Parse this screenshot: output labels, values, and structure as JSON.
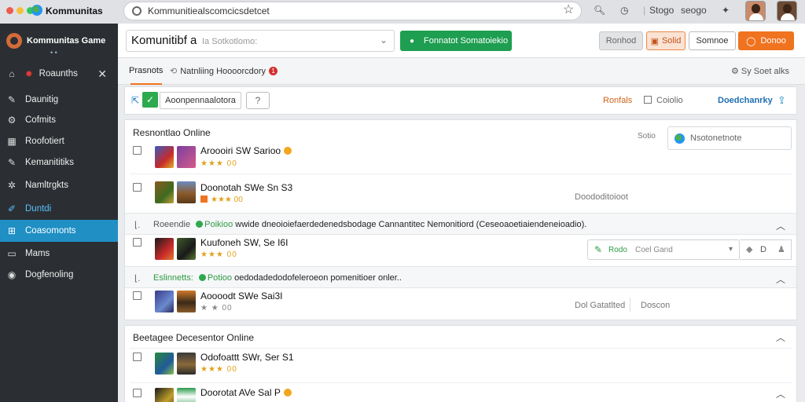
{
  "chrome": {
    "app_title": "Kommunitas",
    "url": "Kommunitiealscomcicsdetcet",
    "ctl1": "Stogo",
    "ctl2": "seogo",
    "colors": {
      "red": "#ee5b50",
      "yellow": "#f6be3a",
      "green": "#34c759"
    }
  },
  "sidebar": {
    "brand": "Kommunitas Game",
    "brand_sub": "• •",
    "items": [
      {
        "label": "Roaunths",
        "icon": "home-icon"
      },
      {
        "label": "Daunitig",
        "icon": "wrench-icon"
      },
      {
        "label": "Cofmits",
        "icon": "gear-icon"
      },
      {
        "label": "Roofotiert",
        "icon": "calendar-icon"
      },
      {
        "label": "Kemanititiks",
        "icon": "wrench-icon"
      },
      {
        "label": "Namltrgkts",
        "icon": "settings-icon"
      },
      {
        "label": "Duntdi",
        "icon": "pencil-icon"
      },
      {
        "label": "Coasomonts",
        "icon": "grid-icon"
      },
      {
        "label": "Mams",
        "icon": "list-icon"
      },
      {
        "label": "Dogfenoling",
        "icon": "circle-icon"
      }
    ]
  },
  "header": {
    "search_label": "Komunitibf a",
    "search_placeholder": "Ia Sotkotlomo:",
    "green_button": "Fonnatot Somatoiekio",
    "gray_button": "Ronhod",
    "orange_outline_button": "Solid",
    "white_button": "Somnoe",
    "orange_button": "Donoo"
  },
  "tabs": {
    "active": "Prasnots",
    "second": "Natnliing Hoooorcdory",
    "second_badge": "1",
    "right": "⚙ Sy Soet alks"
  },
  "toolbar": {
    "input_value": "Aoonpennaalotora",
    "orange_link": "Ronfals",
    "mid_link": "Coiolio",
    "blue_link": "Doedchanrky"
  },
  "panel1": {
    "title": "Resnontlao Online",
    "side_label": "Sotio",
    "side_search": "Nsotonetnote",
    "rows": [
      {
        "name": "Aroooiri SW Sarioo",
        "meta": "★★★ 00",
        "note": ""
      },
      {
        "name": "Doonotah SWe Sn S3",
        "meta": "★★★ 00",
        "note": "Doododitoioot"
      }
    ],
    "info1": {
      "prefix": "Roeendie",
      "green": "Poikioo",
      "text": "wwide dneoioiefaerdedenedsbodage Cannantitec Nemonitiord (Ceseoaoetiaiendeneioadio)."
    },
    "row3": {
      "name": "Kuufoneh SW, Se I6I",
      "meta": "★★★ 00",
      "combo_green": "Rodo",
      "combo_text": "Coel Gand",
      "mini": "D"
    },
    "info2": {
      "prefix": "Eslinnetts:",
      "green": "Potioo",
      "text": "oedodadedodofeleroeon pomenitioer onler.."
    },
    "row4": {
      "name": "Aoooodt SWe Sai3I",
      "meta": "★ ★ 00",
      "note1": "Dol Gatatlted",
      "note2": "Doscon"
    }
  },
  "panel2": {
    "title": "Beetagee Decesentor Online",
    "rows": [
      {
        "name": "Odofoattt SWr, Ser S1",
        "meta": "★★★ 00"
      },
      {
        "name": "Doorotat AVe Sal P",
        "meta": ""
      }
    ]
  }
}
